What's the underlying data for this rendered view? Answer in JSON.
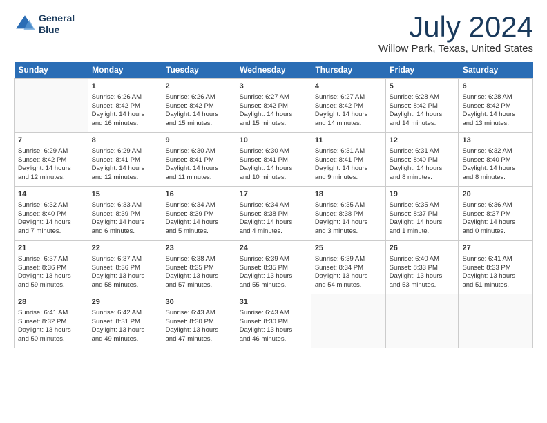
{
  "header": {
    "logo_line1": "General",
    "logo_line2": "Blue",
    "month": "July 2024",
    "location": "Willow Park, Texas, United States"
  },
  "weekdays": [
    "Sunday",
    "Monday",
    "Tuesday",
    "Wednesday",
    "Thursday",
    "Friday",
    "Saturday"
  ],
  "weeks": [
    [
      {
        "day": "",
        "info": ""
      },
      {
        "day": "1",
        "info": "Sunrise: 6:26 AM\nSunset: 8:42 PM\nDaylight: 14 hours\nand 16 minutes."
      },
      {
        "day": "2",
        "info": "Sunrise: 6:26 AM\nSunset: 8:42 PM\nDaylight: 14 hours\nand 15 minutes."
      },
      {
        "day": "3",
        "info": "Sunrise: 6:27 AM\nSunset: 8:42 PM\nDaylight: 14 hours\nand 15 minutes."
      },
      {
        "day": "4",
        "info": "Sunrise: 6:27 AM\nSunset: 8:42 PM\nDaylight: 14 hours\nand 14 minutes."
      },
      {
        "day": "5",
        "info": "Sunrise: 6:28 AM\nSunset: 8:42 PM\nDaylight: 14 hours\nand 14 minutes."
      },
      {
        "day": "6",
        "info": "Sunrise: 6:28 AM\nSunset: 8:42 PM\nDaylight: 14 hours\nand 13 minutes."
      }
    ],
    [
      {
        "day": "7",
        "info": "Sunrise: 6:29 AM\nSunset: 8:42 PM\nDaylight: 14 hours\nand 12 minutes."
      },
      {
        "day": "8",
        "info": "Sunrise: 6:29 AM\nSunset: 8:41 PM\nDaylight: 14 hours\nand 12 minutes."
      },
      {
        "day": "9",
        "info": "Sunrise: 6:30 AM\nSunset: 8:41 PM\nDaylight: 14 hours\nand 11 minutes."
      },
      {
        "day": "10",
        "info": "Sunrise: 6:30 AM\nSunset: 8:41 PM\nDaylight: 14 hours\nand 10 minutes."
      },
      {
        "day": "11",
        "info": "Sunrise: 6:31 AM\nSunset: 8:41 PM\nDaylight: 14 hours\nand 9 minutes."
      },
      {
        "day": "12",
        "info": "Sunrise: 6:31 AM\nSunset: 8:40 PM\nDaylight: 14 hours\nand 8 minutes."
      },
      {
        "day": "13",
        "info": "Sunrise: 6:32 AM\nSunset: 8:40 PM\nDaylight: 14 hours\nand 8 minutes."
      }
    ],
    [
      {
        "day": "14",
        "info": "Sunrise: 6:32 AM\nSunset: 8:40 PM\nDaylight: 14 hours\nand 7 minutes."
      },
      {
        "day": "15",
        "info": "Sunrise: 6:33 AM\nSunset: 8:39 PM\nDaylight: 14 hours\nand 6 minutes."
      },
      {
        "day": "16",
        "info": "Sunrise: 6:34 AM\nSunset: 8:39 PM\nDaylight: 14 hours\nand 5 minutes."
      },
      {
        "day": "17",
        "info": "Sunrise: 6:34 AM\nSunset: 8:38 PM\nDaylight: 14 hours\nand 4 minutes."
      },
      {
        "day": "18",
        "info": "Sunrise: 6:35 AM\nSunset: 8:38 PM\nDaylight: 14 hours\nand 3 minutes."
      },
      {
        "day": "19",
        "info": "Sunrise: 6:35 AM\nSunset: 8:37 PM\nDaylight: 14 hours\nand 1 minute."
      },
      {
        "day": "20",
        "info": "Sunrise: 6:36 AM\nSunset: 8:37 PM\nDaylight: 14 hours\nand 0 minutes."
      }
    ],
    [
      {
        "day": "21",
        "info": "Sunrise: 6:37 AM\nSunset: 8:36 PM\nDaylight: 13 hours\nand 59 minutes."
      },
      {
        "day": "22",
        "info": "Sunrise: 6:37 AM\nSunset: 8:36 PM\nDaylight: 13 hours\nand 58 minutes."
      },
      {
        "day": "23",
        "info": "Sunrise: 6:38 AM\nSunset: 8:35 PM\nDaylight: 13 hours\nand 57 minutes."
      },
      {
        "day": "24",
        "info": "Sunrise: 6:39 AM\nSunset: 8:35 PM\nDaylight: 13 hours\nand 55 minutes."
      },
      {
        "day": "25",
        "info": "Sunrise: 6:39 AM\nSunset: 8:34 PM\nDaylight: 13 hours\nand 54 minutes."
      },
      {
        "day": "26",
        "info": "Sunrise: 6:40 AM\nSunset: 8:33 PM\nDaylight: 13 hours\nand 53 minutes."
      },
      {
        "day": "27",
        "info": "Sunrise: 6:41 AM\nSunset: 8:33 PM\nDaylight: 13 hours\nand 51 minutes."
      }
    ],
    [
      {
        "day": "28",
        "info": "Sunrise: 6:41 AM\nSunset: 8:32 PM\nDaylight: 13 hours\nand 50 minutes."
      },
      {
        "day": "29",
        "info": "Sunrise: 6:42 AM\nSunset: 8:31 PM\nDaylight: 13 hours\nand 49 minutes."
      },
      {
        "day": "30",
        "info": "Sunrise: 6:43 AM\nSunset: 8:30 PM\nDaylight: 13 hours\nand 47 minutes."
      },
      {
        "day": "31",
        "info": "Sunrise: 6:43 AM\nSunset: 8:30 PM\nDaylight: 13 hours\nand 46 minutes."
      },
      {
        "day": "",
        "info": ""
      },
      {
        "day": "",
        "info": ""
      },
      {
        "day": "",
        "info": ""
      }
    ]
  ]
}
